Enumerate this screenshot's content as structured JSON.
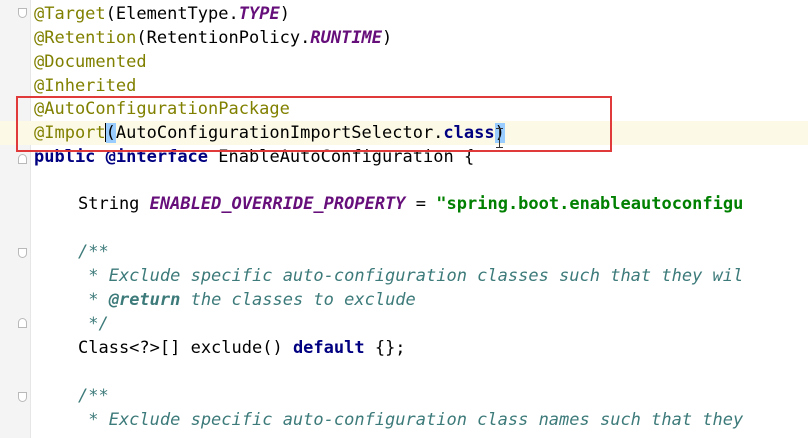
{
  "code": {
    "l1": {
      "anno": "@Target",
      "open": "(",
      "arg": "ElementType.",
      "const": "TYPE",
      "close": ")"
    },
    "l2": {
      "anno": "@Retention",
      "open": "(",
      "arg": "RetentionPolicy.",
      "const": "RUNTIME",
      "close": ")"
    },
    "l3": {
      "anno": "@Documented"
    },
    "l4": {
      "anno": "@Inherited"
    },
    "l5": {
      "anno": "@AutoConfigurationPackage"
    },
    "l6": {
      "anno": "@Import",
      "open": "(",
      "arg": "AutoConfigurationImportSelector.",
      "kw_a": "c",
      "kw_b": "lass",
      "close": ")"
    },
    "l7": {
      "kw1": "public",
      "kw2": "@interface",
      "name": "EnableAutoConfiguration",
      "brace": "{"
    },
    "l9": {
      "type": "String",
      "const": "ENABLED_OVERRIDE_PROPERTY",
      "eq": "=",
      "str": "\"spring.boot.enableautoconfigu"
    },
    "l11": "/**",
    "l12": " * Exclude specific auto-configuration classes such that they wil",
    "l13": {
      "star": " * ",
      "tag": "@return",
      "rest": " the classes to exclude"
    },
    "l14": " */",
    "l15": {
      "sig": "Class<?>[] exclude() ",
      "kw": "default",
      "tail": " {};"
    },
    "l17": "/**",
    "l18": " * Exclude specific auto-configuration class names such that they"
  },
  "colors": {
    "annotation": "#808000",
    "keyword": "#000080",
    "constant": "#660e7a",
    "string": "#008000",
    "javadoc": "#3d7a7a",
    "highlight_box": "#e03a3a",
    "brace_match": "#99ccff",
    "caret_line": "#fcfae6"
  }
}
